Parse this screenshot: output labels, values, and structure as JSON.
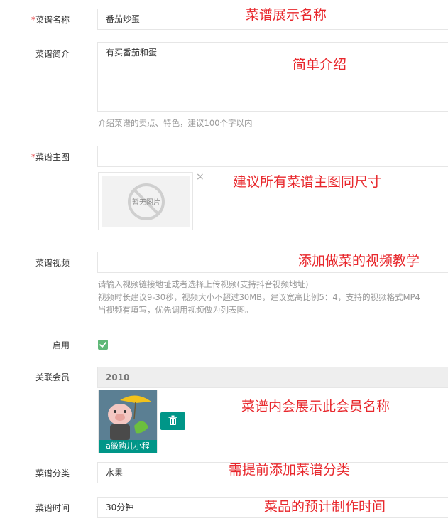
{
  "form": {
    "required_mark": "*",
    "name": {
      "label": "菜谱名称",
      "value": "番茄炒蛋"
    },
    "intro": {
      "label": "菜谱简介",
      "value": "有买番茄和蛋",
      "help": "介绍菜谱的卖点、特色，建议100个字以内"
    },
    "image": {
      "label": "菜谱主图",
      "placeholder_text": "暂无图片",
      "remove": "×"
    },
    "video": {
      "label": "菜谱视频",
      "help_lines": [
        "请输入视频链接地址或者选择上传视频(支持抖音视频地址)",
        "视频时长建议9-30秒，视频大小不超过30MB，建议宽高比例5：4，支持的视频格式MP4",
        "当视频有填写，优先调用视频做为列表图。"
      ]
    },
    "enabled": {
      "label": "启用",
      "checked": true
    },
    "member": {
      "label": "关联会员",
      "value": "2010",
      "avatar_caption": "a微购儿小程"
    },
    "category": {
      "label": "菜谱分类",
      "value": "水果"
    },
    "time": {
      "label": "菜谱时间",
      "value": "30分钟"
    }
  },
  "annotations": {
    "name": "菜谱展示名称",
    "intro": "简单介绍",
    "image": "建议所有菜谱主图同尺寸",
    "video": "添加做菜的视频教学",
    "member": "菜谱内会展示此会员名称",
    "category": "需提前添加菜谱分类",
    "time": "菜品的预计制作时间"
  },
  "colors": {
    "annotation": "#e8282d",
    "required": "#e4393c",
    "accent": "#009688",
    "checkbox": "#5fb878"
  },
  "icons": {
    "no_image": "no-image-icon",
    "remove": "close-icon",
    "check": "check-icon",
    "delete": "trash-icon"
  }
}
